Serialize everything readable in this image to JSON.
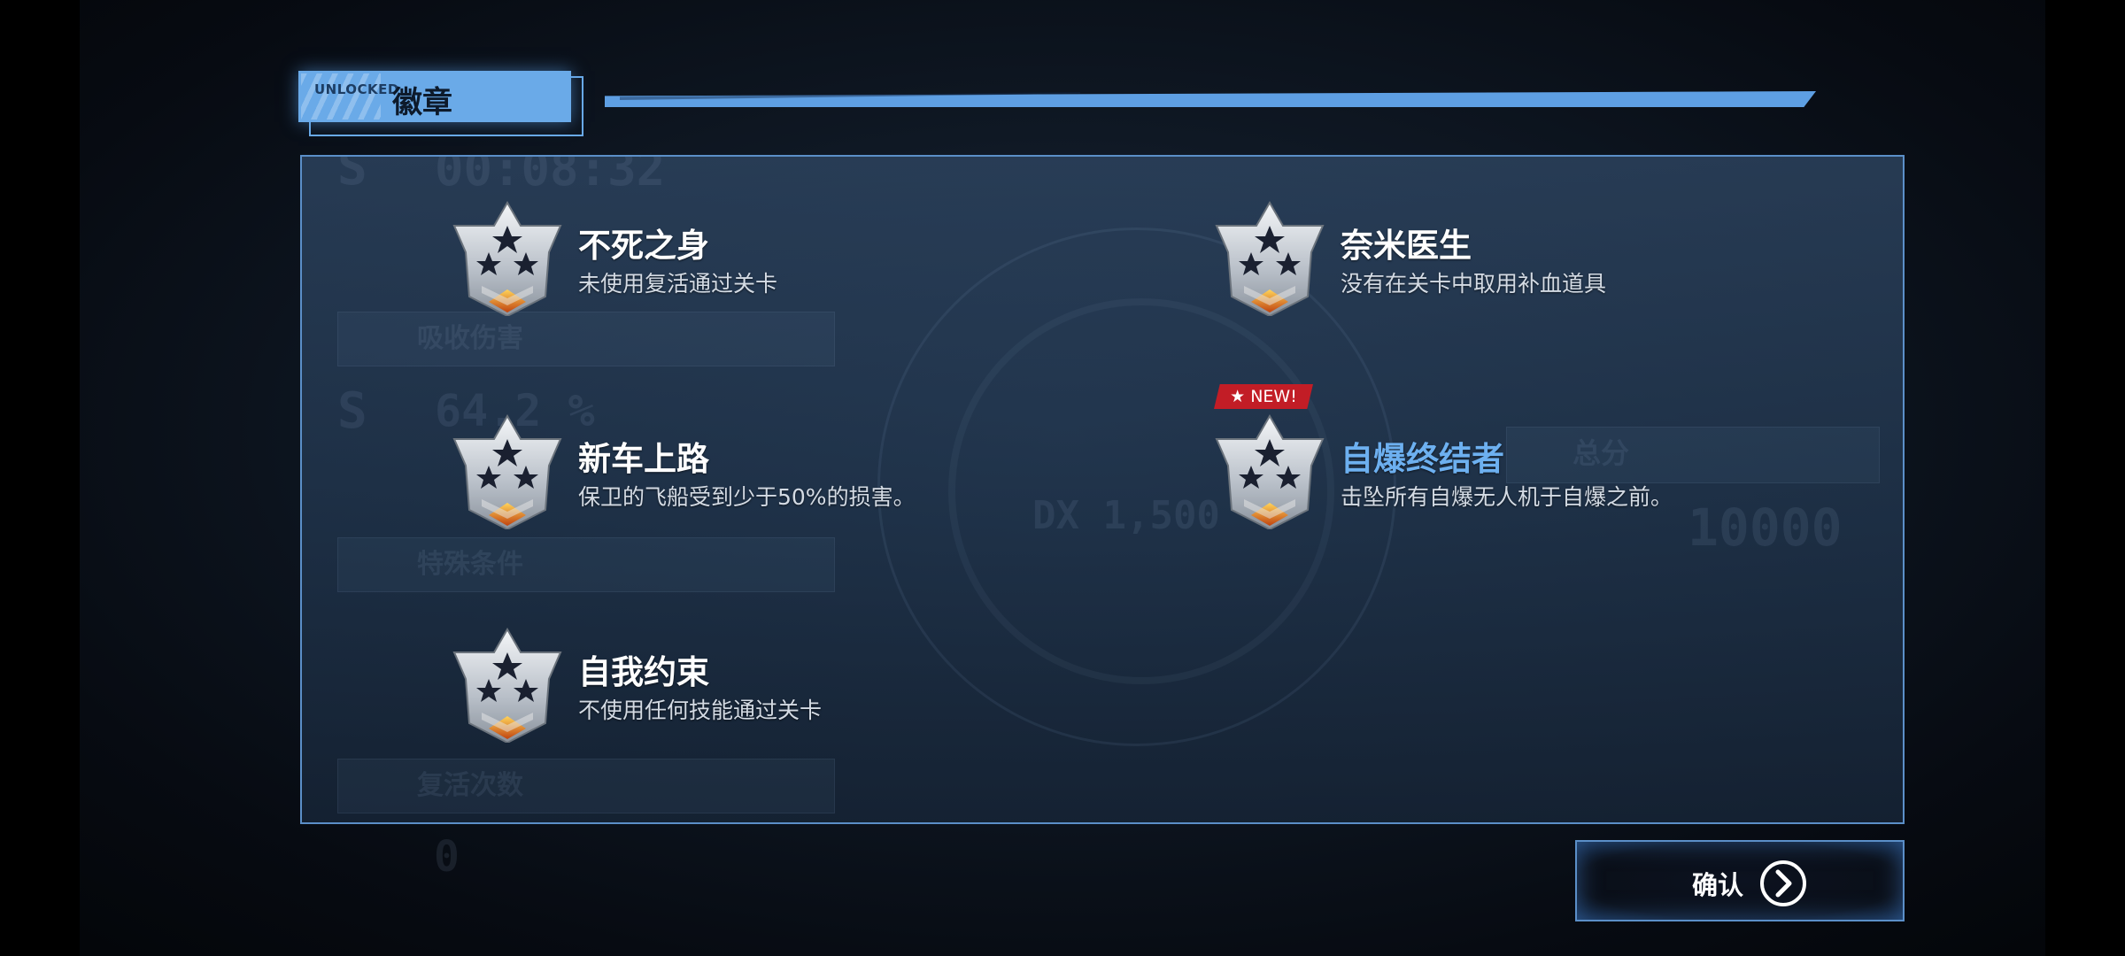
{
  "header": {
    "tag_small": "UNLOCKED",
    "title": "徽章"
  },
  "badges": [
    {
      "name": "不死之身",
      "description": "未使用复活通过关卡",
      "is_new": false
    },
    {
      "name": "奈米医生",
      "description": "没有在关卡中取用补血道具",
      "is_new": false
    },
    {
      "name": "新车上路",
      "description": "保卫的飞船受到少于50%的损害。",
      "is_new": false
    },
    {
      "name": "自爆终结者",
      "description": "击坠所有自爆无人机于自爆之前。",
      "is_new": true,
      "new_label": "★ NEW!"
    },
    {
      "name": "自我约束",
      "description": "不使用任何技能通过关卡",
      "is_new": false
    }
  ],
  "background_ghost": {
    "time": "00:08:32",
    "rank1": "S",
    "percent": "64.2 %",
    "rank2": "S",
    "label1": "吸收伤害",
    "label2": "特殊条件",
    "label3": "复活次数",
    "revive_count": "0",
    "score_label": "总分",
    "score": "10000",
    "bonus": "DX 1,500"
  },
  "confirm_button": {
    "label": "确认"
  },
  "colors": {
    "accent": "#6aaae8",
    "highlight_text": "#6db0f0",
    "new_tag": "#c21d26",
    "panel_border": "#5b8fc8"
  }
}
